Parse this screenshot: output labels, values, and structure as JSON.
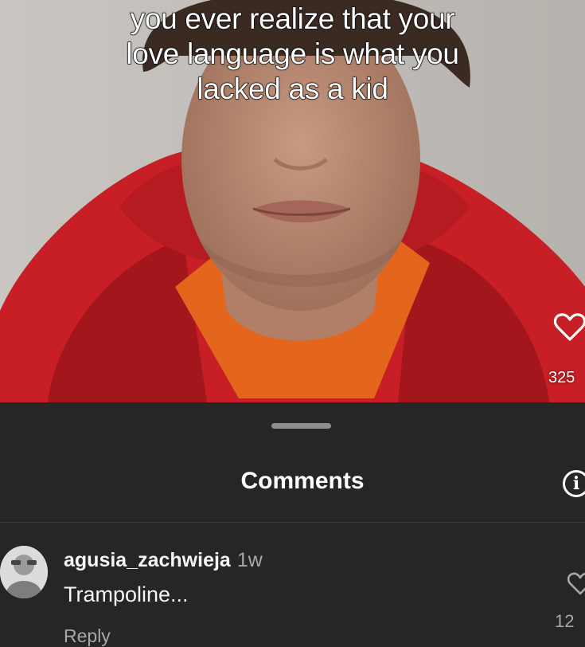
{
  "video": {
    "caption_lines": [
      "you ever realize that your",
      "love language is what you",
      "lacked as a kid"
    ],
    "like_count": "325"
  },
  "comments_sheet": {
    "title": "Comments",
    "comments": [
      {
        "username": "agusia_zachwieja",
        "time": "1w",
        "text": "Trampoline...",
        "reply_label": "Reply",
        "like_count": "12"
      }
    ]
  },
  "colors": {
    "sheet_background": "#262626",
    "text_primary": "#f5f5f5",
    "text_secondary": "#a8a8a8",
    "hoodie_red": "#c71f25"
  },
  "icons": {
    "video_like": "heart-outline-icon",
    "info": "info-icon",
    "comment_like": "heart-outline-icon"
  }
}
